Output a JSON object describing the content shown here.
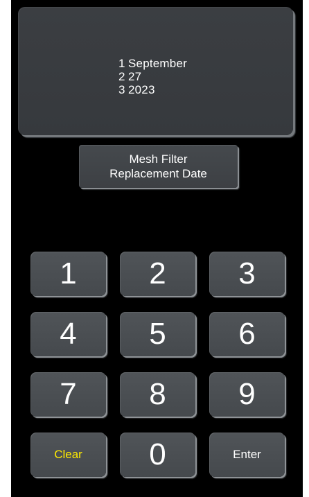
{
  "display": {
    "lines": [
      {
        "num": "1",
        "value": "September"
      },
      {
        "num": "2",
        "value": "27"
      },
      {
        "num": "3",
        "value": "2023"
      }
    ]
  },
  "title_button": {
    "line1": "Mesh Filter",
    "line2": "Replacement Date"
  },
  "keypad": {
    "k1": "1",
    "k2": "2",
    "k3": "3",
    "k4": "4",
    "k5": "5",
    "k6": "6",
    "k7": "7",
    "k8": "8",
    "k9": "9",
    "k0": "0",
    "clear": "Clear",
    "enter": "Enter"
  },
  "colors": {
    "background": "#000000",
    "panel": "#3b3e42",
    "key": "#4a4e52",
    "text": "#ffffff",
    "clear_text": "#ffeb00"
  }
}
